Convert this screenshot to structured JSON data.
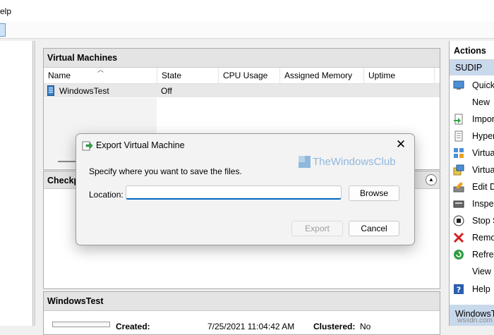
{
  "menubar": {
    "help": "elp"
  },
  "vm_pane": {
    "title": "Virtual Machines",
    "columns": [
      "Name",
      "State",
      "CPU Usage",
      "Assigned Memory",
      "Uptime"
    ],
    "rows": [
      {
        "name": "WindowsTest",
        "state": "Off"
      }
    ]
  },
  "checkpoint_pane": {
    "title": "Checkp"
  },
  "detail_pane": {
    "title": "WindowsTest",
    "created_label": "Created:",
    "created_value": "7/25/2021 11:04:42 AM",
    "clustered_label": "Clustered:",
    "clustered_value": "No"
  },
  "actions": {
    "title": "Actions",
    "subtitle": "SUDIP",
    "items": [
      {
        "label": "Quick",
        "icon": "quick-create-icon"
      },
      {
        "label": "New",
        "icon": "none"
      },
      {
        "label": "Impor",
        "icon": "import-icon"
      },
      {
        "label": "Hyper",
        "icon": "hyper-v-settings-icon"
      },
      {
        "label": "Virtua",
        "icon": "virtual-switch-icon"
      },
      {
        "label": "Virtua",
        "icon": "virtual-san-icon"
      },
      {
        "label": "Edit D",
        "icon": "edit-disk-icon"
      },
      {
        "label": "Inspec",
        "icon": "inspect-disk-icon"
      },
      {
        "label": "Stop S",
        "icon": "stop-service-icon"
      },
      {
        "label": "Remo",
        "icon": "remove-server-icon"
      },
      {
        "label": "Refres",
        "icon": "refresh-icon"
      },
      {
        "label": "View",
        "icon": "none"
      },
      {
        "label": "Help",
        "icon": "help-icon"
      }
    ],
    "bottom": "WindowsT"
  },
  "dialog": {
    "title": "Export Virtual Machine",
    "prompt": "Specify where you want to save the files.",
    "location_label": "Location:",
    "location_value": "",
    "browse": "Browse",
    "export": "Export",
    "cancel": "Cancel"
  },
  "watermark": {
    "brand": "TheWindowsClub",
    "site": "wsxdn.com"
  },
  "colors": {
    "accent": "#0067c0",
    "actions_highlight": "#c9d9ec",
    "pane_header": "#e4e4e4"
  }
}
